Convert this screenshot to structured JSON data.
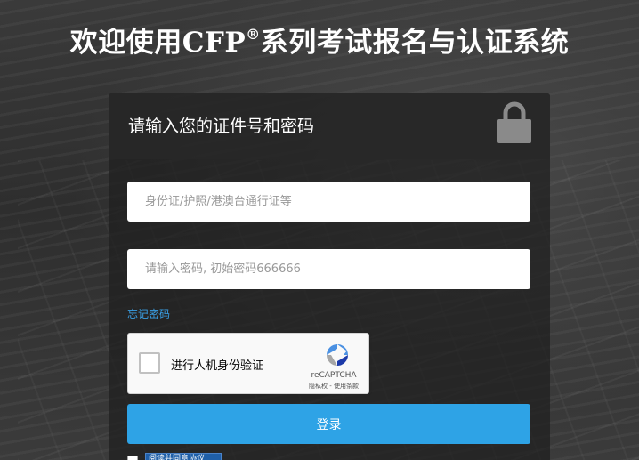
{
  "header": {
    "title_prefix": "欢迎使用CFP",
    "title_registered": "®",
    "title_suffix": "系列考试报名与认证系统"
  },
  "login_card": {
    "title": "请输入您的证件号和密码",
    "lock_icon": "lock-icon",
    "id_input": {
      "value": "",
      "placeholder": "身份证/护照/港澳台通行证等"
    },
    "password_input": {
      "value": "",
      "placeholder": "请输入密码, 初始密码666666"
    },
    "forgot_password_label": "忘记密码",
    "recaptcha": {
      "label": "进行人机身份验证",
      "brand": "reCAPTCHA",
      "terms": "隐私权 - 使用条款",
      "checked": false
    },
    "login_label": "登录",
    "agree_link_label": "阅读并同意协议",
    "agree_checked": false
  },
  "colors": {
    "accent": "#2ea3e6",
    "link": "#3aa0e6",
    "card_bg": "#1e1e1e"
  }
}
